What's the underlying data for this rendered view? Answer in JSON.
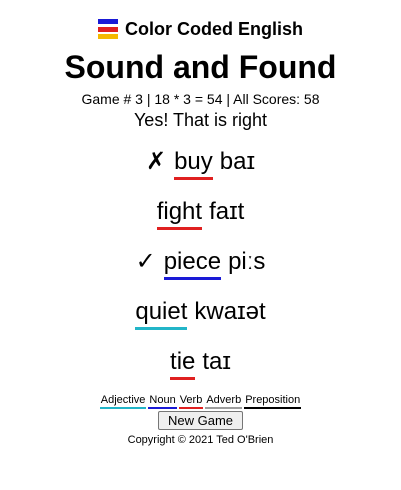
{
  "brand": {
    "title": "Color Coded English",
    "flag_colors": [
      "#1a1ad6",
      "#e02020",
      "#f5b800"
    ]
  },
  "game": {
    "title": "Sound and Found",
    "score_line": "Game # 3 | 18 * 3 = 54 | All Scores: 58",
    "feedback": "Yes! That is right"
  },
  "words": [
    {
      "mark": "✗",
      "word": "buy",
      "ipa": "baɪ",
      "color": "#e02020"
    },
    {
      "mark": "",
      "word": "fight",
      "ipa": "faɪt",
      "color": "#e02020"
    },
    {
      "mark": "✓",
      "word": "piece",
      "ipa": "piːs",
      "color": "#1a1ad6"
    },
    {
      "mark": "",
      "word": "quiet",
      "ipa": "kwaɪət",
      "color": "#22b5c8"
    },
    {
      "mark": "",
      "word": "tie",
      "ipa": "taɪ",
      "color": "#e02020"
    }
  ],
  "legend": [
    {
      "label": "Adjective",
      "color": "#22b5c8"
    },
    {
      "label": "Noun",
      "color": "#1a1ad6"
    },
    {
      "label": "Verb",
      "color": "#e02020"
    },
    {
      "label": "Adverb",
      "color": "#9d9d9d"
    },
    {
      "label": "Preposition",
      "color": "#000000"
    }
  ],
  "controls": {
    "new_game_label": "New Game"
  },
  "footer": {
    "copyright": "Copyright © 2021 Ted O'Brien"
  }
}
